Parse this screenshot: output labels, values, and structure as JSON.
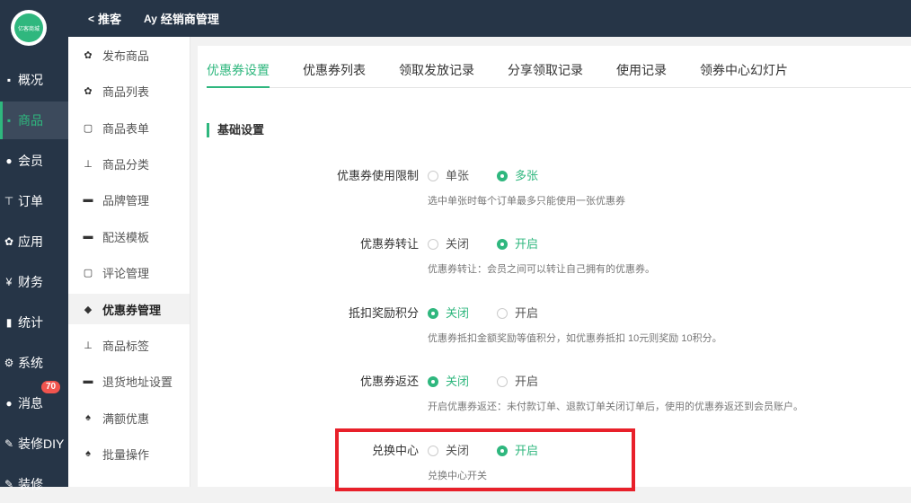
{
  "header": {
    "logo_text": "亿客商城",
    "links": [
      {
        "icon": "share-icon",
        "label": "推客"
      },
      {
        "icon": "dealer-icon",
        "label": "经销商管理"
      }
    ]
  },
  "leftnav": [
    {
      "icon": "overview-icon",
      "label": "概况",
      "active": false
    },
    {
      "icon": "goods-icon",
      "label": "商品",
      "active": true
    },
    {
      "icon": "members-icon",
      "label": "会员",
      "active": false
    },
    {
      "icon": "cart-icon",
      "label": "订单",
      "active": false
    },
    {
      "icon": "apps-icon",
      "label": "应用",
      "active": false
    },
    {
      "icon": "yen-icon",
      "label": "财务",
      "active": false
    },
    {
      "icon": "chart-icon",
      "label": "统计",
      "active": false
    },
    {
      "icon": "gear-icon",
      "label": "系统",
      "active": false
    },
    {
      "icon": "message-icon",
      "label": "消息",
      "active": false,
      "badge": "70"
    },
    {
      "icon": "brush-icon",
      "label": "装修DIY",
      "active": false
    },
    {
      "icon": "brush-icon",
      "label": "装修",
      "active": false
    }
  ],
  "subnav": [
    {
      "icon": "apps-icon",
      "label": "发布商品"
    },
    {
      "icon": "apps-icon",
      "label": "商品列表"
    },
    {
      "icon": "form-icon",
      "label": "商品表单"
    },
    {
      "icon": "sitemap-icon",
      "label": "商品分类"
    },
    {
      "icon": "briefcase-icon",
      "label": "品牌管理"
    },
    {
      "icon": "truck-icon",
      "label": "配送模板"
    },
    {
      "icon": "comment-icon",
      "label": "评论管理"
    },
    {
      "icon": "tag-icon",
      "label": "优惠券管理",
      "active": true
    },
    {
      "icon": "sitemap-icon",
      "label": "商品标签"
    },
    {
      "icon": "truck-icon",
      "label": "退货地址设置"
    },
    {
      "icon": "gift-icon",
      "label": "满额优惠"
    },
    {
      "icon": "gift-icon",
      "label": "批量操作"
    }
  ],
  "tabs": [
    {
      "label": "优惠券设置",
      "active": true
    },
    {
      "label": "优惠券列表"
    },
    {
      "label": "领取发放记录"
    },
    {
      "label": "分享领取记录"
    },
    {
      "label": "使用记录"
    },
    {
      "label": "领券中心幻灯片"
    }
  ],
  "section_title": "基础设置",
  "settings": [
    {
      "label": "优惠券使用限制",
      "options": [
        "单张",
        "多张"
      ],
      "selected": 1,
      "help": "选中单张时每个订单最多只能使用一张优惠券"
    },
    {
      "label": "优惠券转让",
      "options": [
        "关闭",
        "开启"
      ],
      "selected": 1,
      "help": "优惠券转让：会员之间可以转让自己拥有的优惠券。"
    },
    {
      "label": "抵扣奖励积分",
      "options": [
        "关闭",
        "开启"
      ],
      "selected": 0,
      "help": "优惠券抵扣金额奖励等值积分，如优惠券抵扣 10元则奖励 10积分。"
    },
    {
      "label": "优惠券返还",
      "options": [
        "关闭",
        "开启"
      ],
      "selected": 0,
      "help": "开启优惠券返还：未付款订单、退款订单关闭订单后，使用的优惠券返还到会员账户。"
    },
    {
      "label": "兑换中心",
      "options": [
        "关闭",
        "开启"
      ],
      "selected": 1,
      "help": "兑换中心开关"
    }
  ],
  "colors": {
    "accent": "#2fb77e",
    "sidebar": "#263547",
    "highlight": "#e8202a",
    "badge": "#f0544e"
  }
}
